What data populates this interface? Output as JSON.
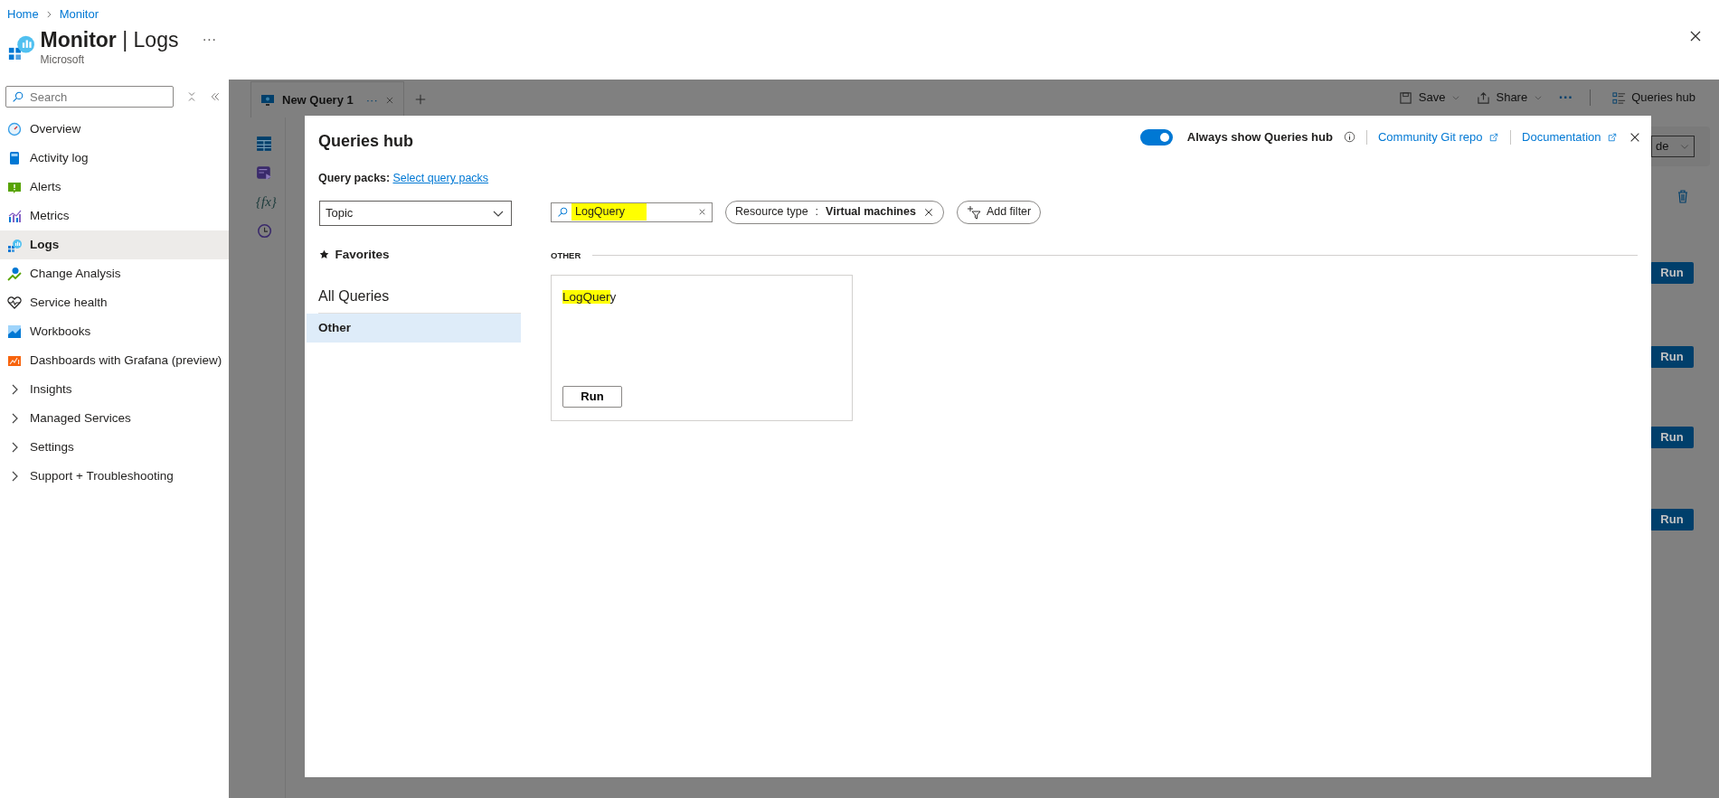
{
  "breadcrumbs": [
    "Home",
    "Monitor"
  ],
  "header": {
    "title": "**Monitor** | Logs",
    "subtitle": "Microsoft",
    "more": "···"
  },
  "sidebar": {
    "search": {
      "placeholder": "Search"
    },
    "items": [
      {
        "label": "Overview",
        "kind": "link",
        "selected": false
      },
      {
        "label": "Activity log",
        "kind": "link",
        "selected": false
      },
      {
        "label": "Alerts",
        "kind": "link",
        "selected": false
      },
      {
        "label": "Metrics",
        "kind": "link",
        "selected": false
      },
      {
        "label": "Logs",
        "kind": "link",
        "selected": true
      },
      {
        "label": "Change Analysis",
        "kind": "link",
        "selected": false
      },
      {
        "label": "Service health",
        "kind": "link",
        "selected": false
      },
      {
        "label": "Workbooks",
        "kind": "link",
        "selected": false
      },
      {
        "label": "Dashboards with Grafana (preview)",
        "kind": "link",
        "selected": false
      },
      {
        "label": "Insights",
        "kind": "group",
        "expanded": false,
        "selected": false
      },
      {
        "label": "Managed Services",
        "kind": "group",
        "expanded": false,
        "selected": false
      },
      {
        "label": "Settings",
        "kind": "group",
        "expanded": false,
        "selected": false
      },
      {
        "label": "Support + Troubleshooting",
        "kind": "group",
        "expanded": false,
        "selected": false
      }
    ]
  },
  "workspace": {
    "tab": {
      "label": "New Query 1",
      "more": "···"
    },
    "toolbar": [
      {
        "label": "Save",
        "kind": "menu"
      },
      {
        "label": "Share",
        "kind": "menu"
      },
      {
        "label": "···",
        "kind": "more"
      },
      {
        "label": "Queries hub",
        "kind": "plain"
      }
    ],
    "function_label": "{fx}",
    "dropdown": "de",
    "run_buttons": [
      "Run",
      "Run",
      "Run",
      "Run"
    ]
  },
  "queries_hub": {
    "title": "Queries hub",
    "always_show": {
      "label": "Always show Queries hub",
      "on": true
    },
    "links": [
      "Community Git repo",
      "Documentation"
    ],
    "query_packs": {
      "label": "Query packs:",
      "link": "Select query packs"
    },
    "topic": {
      "value": "Topic"
    },
    "favorites": "Favorites",
    "all_queries": "All Queries",
    "categories": [
      {
        "label": "Other",
        "selected": true
      }
    ],
    "search": {
      "value": "LogQuery",
      "highlighted": true
    },
    "filters": [
      {
        "label": "Resource type",
        "separator": ":",
        "value": "Virtual machines"
      }
    ],
    "add_filter": "Add filter",
    "section": "OTHER",
    "queries": [
      {
        "title_parts": [
          {
            "text": "LogQuer",
            "highlighted": true
          },
          {
            "text": "y",
            "highlighted": false
          }
        ],
        "run": "Run"
      }
    ]
  }
}
